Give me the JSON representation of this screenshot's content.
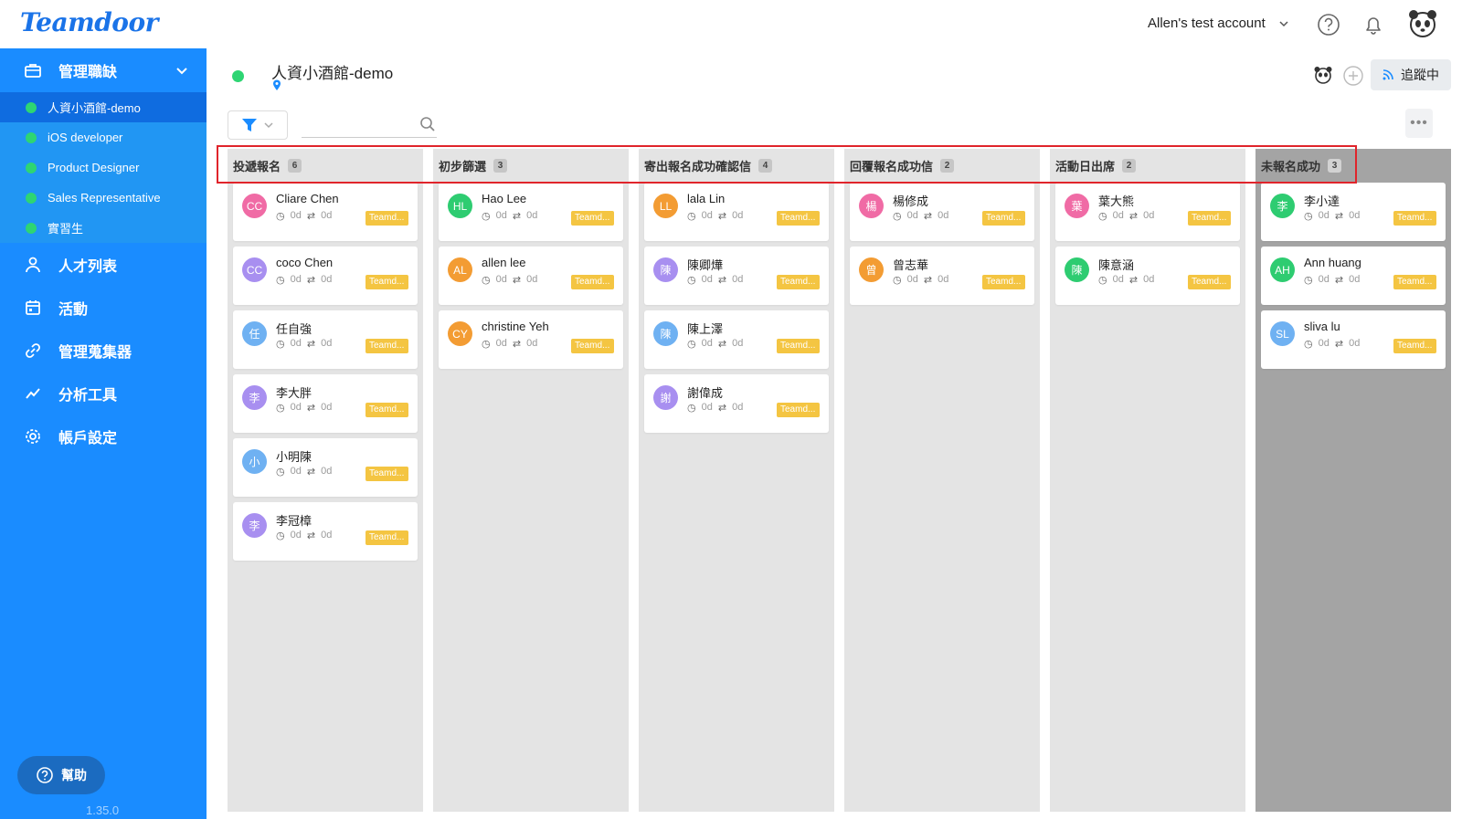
{
  "app": {
    "logo": "Teamdoor"
  },
  "topbar": {
    "account": "Allen's test account"
  },
  "sidebar": {
    "section_label": "管理職缺",
    "jobs": [
      {
        "label": "人資小酒館-demo",
        "active": true
      },
      {
        "label": "iOS developer"
      },
      {
        "label": "Product Designer"
      },
      {
        "label": "Sales Representative"
      },
      {
        "label": "實習生"
      }
    ],
    "nav": [
      {
        "label": "人才列表",
        "icon": "person-icon"
      },
      {
        "label": "活動",
        "icon": "calendar-icon"
      },
      {
        "label": "管理蒐集器",
        "icon": "link-icon"
      },
      {
        "label": "分析工具",
        "icon": "chart-icon"
      },
      {
        "label": "帳戶設定",
        "icon": "gear-icon"
      }
    ],
    "help_label": "幫助",
    "version": "1.35.0"
  },
  "main": {
    "job_title": "人資小酒館-demo",
    "track_label": "追蹤中",
    "search_placeholder": ""
  },
  "columns": [
    {
      "title": "投遞報名",
      "count": "6",
      "cards": [
        {
          "initials": "CC",
          "name": "Cliare Chen",
          "color": "#f06ba5"
        },
        {
          "initials": "CC",
          "name": "coco Chen",
          "color": "#a88ff0"
        },
        {
          "initials": "任",
          "name": "任自強",
          "color": "#6fb1f2"
        },
        {
          "initials": "李",
          "name": "李大胖",
          "color": "#a88ff0"
        },
        {
          "initials": "小",
          "name": "小明陳",
          "color": "#6fb1f2"
        },
        {
          "initials": "李",
          "name": "李冠樟",
          "color": "#a88ff0"
        }
      ]
    },
    {
      "title": "初步篩選",
      "count": "3",
      "cards": [
        {
          "initials": "HL",
          "name": "Hao Lee",
          "color": "#2ecc71"
        },
        {
          "initials": "AL",
          "name": "allen lee",
          "color": "#f39c33"
        },
        {
          "initials": "CY",
          "name": "christine Yeh",
          "color": "#f39c33"
        }
      ]
    },
    {
      "title": "寄出報名成功確認信",
      "count": "4",
      "cards": [
        {
          "initials": "LL",
          "name": "lala Lin",
          "color": "#f39c33"
        },
        {
          "initials": "陳",
          "name": "陳卿燁",
          "color": "#a88ff0"
        },
        {
          "initials": "陳",
          "name": "陳上澤",
          "color": "#6fb1f2"
        },
        {
          "initials": "謝",
          "name": "謝偉成",
          "color": "#a88ff0"
        }
      ]
    },
    {
      "title": "回覆報名成功信",
      "count": "2",
      "cards": [
        {
          "initials": "楊",
          "name": "楊修成",
          "color": "#f06ba5"
        },
        {
          "initials": "曾",
          "name": "曾志華",
          "color": "#f39c33"
        }
      ]
    },
    {
      "title": "活動日出席",
      "count": "2",
      "cards": [
        {
          "initials": "葉",
          "name": "葉大熊",
          "color": "#f06ba5"
        },
        {
          "initials": "陳",
          "name": "陳意涵",
          "color": "#2ecc71"
        }
      ]
    },
    {
      "title": "未報名成功",
      "count": "3",
      "cards": [
        {
          "initials": "李",
          "name": "李小達",
          "color": "#2ecc71"
        },
        {
          "initials": "AH",
          "name": "Ann huang",
          "color": "#2ecc71"
        },
        {
          "initials": "SL",
          "name": "sliva lu",
          "color": "#6fb1f2"
        }
      ]
    }
  ],
  "card_meta": {
    "days": "0d",
    "moves": "0d",
    "tag": "Teamd..."
  },
  "colors": {
    "primary": "#1a8cff",
    "accent": "#2ed573",
    "tag": "#f4c542",
    "highlight": "#e0242b"
  }
}
